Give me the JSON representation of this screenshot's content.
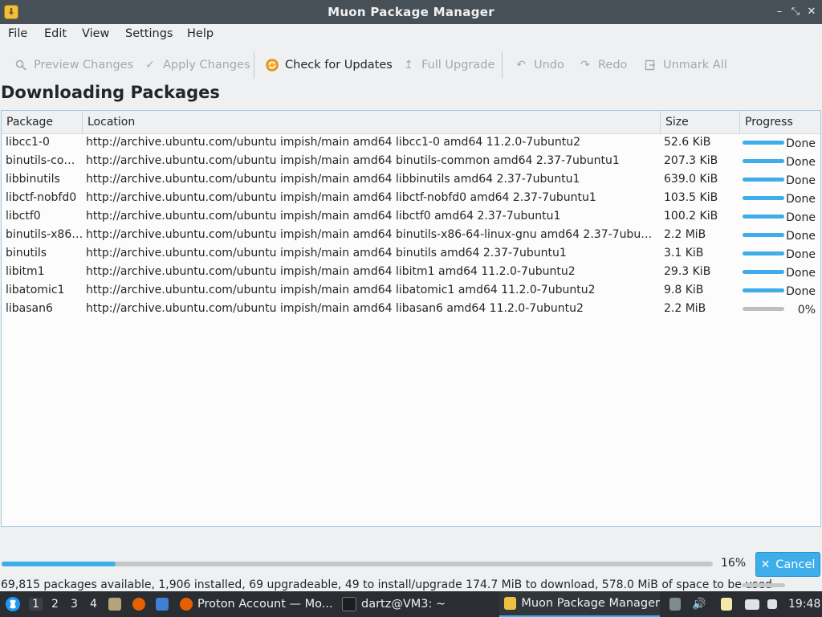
{
  "window": {
    "title": "Muon Package Manager"
  },
  "menu": [
    "File",
    "Edit",
    "View",
    "Settings",
    "Help"
  ],
  "toolbar": {
    "preview": "Preview Changes",
    "apply": "Apply Changes",
    "check": "Check for Updates",
    "upgrade": "Full Upgrade",
    "undo": "Undo",
    "redo": "Redo",
    "unmark": "Unmark All"
  },
  "heading": "Downloading Packages",
  "table": {
    "columns": [
      "Package",
      "Location",
      "Size",
      "Progress"
    ],
    "rows": [
      {
        "pkg": "libcc1-0",
        "loc": "http://archive.ubuntu.com/ubuntu impish/main amd64 libcc1-0 amd64 11.2.0-7ubuntu2",
        "size": "52.6 KiB",
        "progress": 1.0,
        "status": "Done"
      },
      {
        "pkg": "binutils-com...",
        "loc": "http://archive.ubuntu.com/ubuntu impish/main amd64 binutils-common amd64 2.37-7ubuntu1",
        "size": "207.3 KiB",
        "progress": 1.0,
        "status": "Done"
      },
      {
        "pkg": "libbinutils",
        "loc": "http://archive.ubuntu.com/ubuntu impish/main amd64 libbinutils amd64 2.37-7ubuntu1",
        "size": "639.0 KiB",
        "progress": 1.0,
        "status": "Done"
      },
      {
        "pkg": "libctf-nobfd0",
        "loc": "http://archive.ubuntu.com/ubuntu impish/main amd64 libctf-nobfd0 amd64 2.37-7ubuntu1",
        "size": "103.5 KiB",
        "progress": 1.0,
        "status": "Done"
      },
      {
        "pkg": "libctf0",
        "loc": "http://archive.ubuntu.com/ubuntu impish/main amd64 libctf0 amd64 2.37-7ubuntu1",
        "size": "100.2 KiB",
        "progress": 1.0,
        "status": "Done"
      },
      {
        "pkg": "binutils-x86-...",
        "loc": "http://archive.ubuntu.com/ubuntu impish/main amd64 binutils-x86-64-linux-gnu amd64 2.37-7ubuntu1",
        "size": "2.2 MiB",
        "progress": 1.0,
        "status": "Done"
      },
      {
        "pkg": "binutils",
        "loc": "http://archive.ubuntu.com/ubuntu impish/main amd64 binutils amd64 2.37-7ubuntu1",
        "size": "3.1 KiB",
        "progress": 1.0,
        "status": "Done"
      },
      {
        "pkg": "libitm1",
        "loc": "http://archive.ubuntu.com/ubuntu impish/main amd64 libitm1 amd64 11.2.0-7ubuntu2",
        "size": "29.3 KiB",
        "progress": 1.0,
        "status": "Done"
      },
      {
        "pkg": "libatomic1",
        "loc": "http://archive.ubuntu.com/ubuntu impish/main amd64 libatomic1 amd64 11.2.0-7ubuntu2",
        "size": "9.8 KiB",
        "progress": 1.0,
        "status": "Done"
      },
      {
        "pkg": "libasan6",
        "loc": "http://archive.ubuntu.com/ubuntu impish/main amd64 libasan6 amd64 11.2.0-7ubuntu2",
        "size": "2.2 MiB",
        "progress": 0.0,
        "status": "0%"
      }
    ]
  },
  "overall": {
    "progress": 0.16,
    "percent_text": "16%",
    "cancel": "Cancel"
  },
  "status": "69,815 packages available, 1,906 installed, 69 upgradeable, 49 to install/upgrade  174.7 MiB to download, 578.0 MiB of space to be used",
  "taskbar": {
    "workspaces": [
      "1",
      "2",
      "3",
      "4"
    ],
    "tasks": [
      "Proton Account — Mo...",
      "dartz@VM3: ~",
      "Muon Package Manager"
    ],
    "clock": "19:48"
  },
  "colors": {
    "accent": "#3daee9",
    "titlebar": "#475057",
    "taskbar": "#2a2e32"
  }
}
